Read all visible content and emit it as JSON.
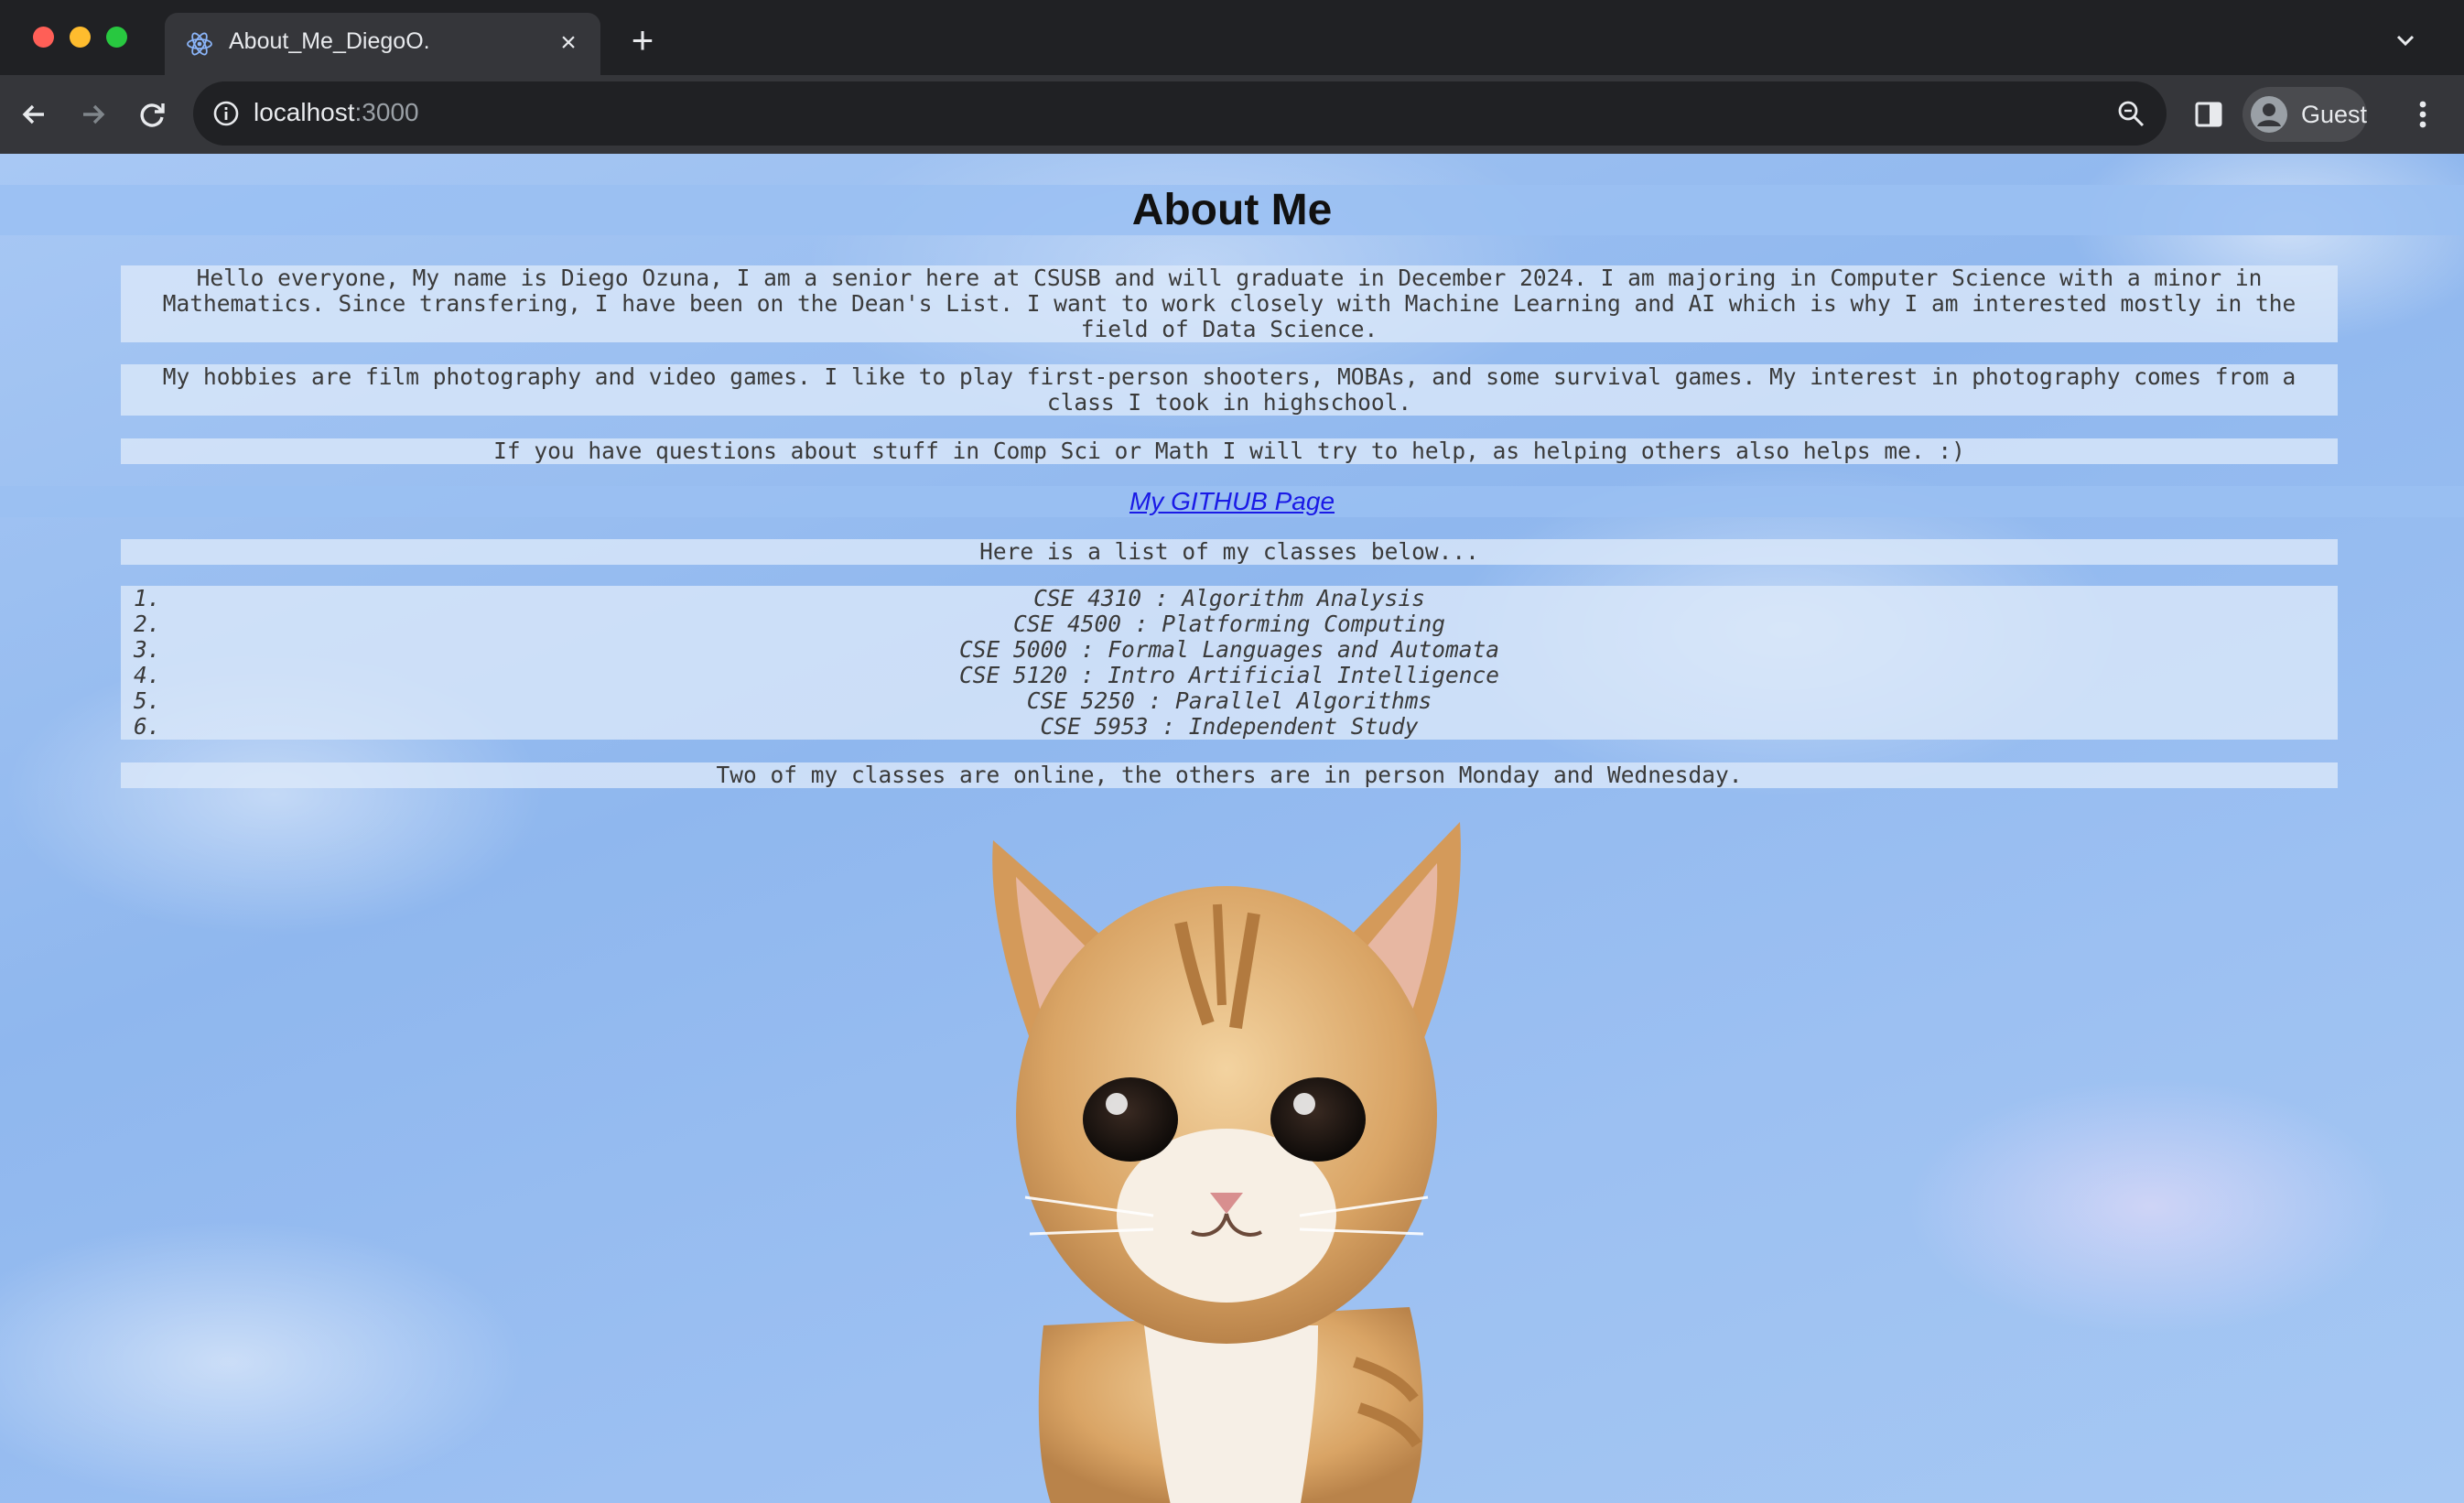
{
  "browser": {
    "tab_title": "About_Me_DiegoO.",
    "url_host": "localhost",
    "url_port": ":3000",
    "profile_label": "Guest",
    "colors": {
      "chrome_bg": "#202124",
      "toolbar_bg": "#35363a",
      "omnibox_bg": "#202124"
    }
  },
  "page": {
    "title": "About Me",
    "paragraphs": {
      "intro": "Hello everyone, My name is Diego Ozuna, I am a senior here at CSUSB and will graduate in December 2024. I am majoring in Computer Science with a minor in Mathematics. Since transfering, I have been on the Dean's List. I want to work closely with Machine Learning and AI which is why I am interested mostly in the field of Data Science.",
      "hobbies": "My hobbies are film photography and video games. I like to play first-person shooters, MOBAs, and some survival games. My interest in photography comes from a class I took in highschool.",
      "help": "If you have questions about stuff in Comp Sci or Math I will try to help, as helping others also helps me. :)"
    },
    "github_link": "My GITHUB Page",
    "classes_intro": "Here is a list of my classes below...",
    "classes": [
      {
        "num": "1.",
        "name": "CSE 4310 : Algorithm Analysis"
      },
      {
        "num": "2.",
        "name": "CSE 4500 : Platforming Computing"
      },
      {
        "num": "3.",
        "name": "CSE 5000 : Formal Languages and Automata"
      },
      {
        "num": "4.",
        "name": "CSE 5120 : Intro Artificial Intelligence"
      },
      {
        "num": "5.",
        "name": "CSE 5250 : Parallel Algorithms"
      },
      {
        "num": "6.",
        "name": "CSE 5953 : Independent Study"
      }
    ],
    "schedule_note": "Two of my classes are online, the others are in person Monday and Wednesday.",
    "image": "kitten-illustration",
    "colors": {
      "link": "#1a1ae6",
      "sky": "#8fb7ee",
      "text_box": "#dce9fa"
    }
  }
}
